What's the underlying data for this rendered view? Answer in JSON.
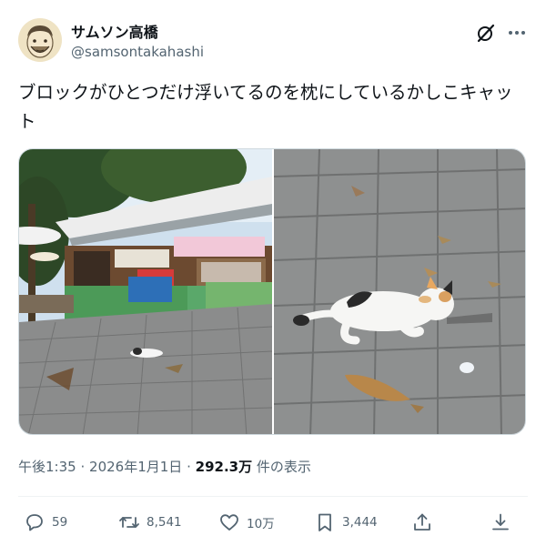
{
  "author": {
    "name": "サムソン高橋",
    "handle": "@samsontakahashi"
  },
  "post": {
    "text": "ブロックがひとつだけ浮いてるのを枕にしているかしこキャット"
  },
  "meta": {
    "time": "午後1:35",
    "separator": "·",
    "date": "2026年1月1日",
    "views_count": "292.3万",
    "views_label": "件の表示"
  },
  "actions": {
    "replies": "59",
    "reposts": "8,541",
    "likes": "10万",
    "bookmarks": "3,444"
  },
  "icons": [
    "grok-icon",
    "more-icon",
    "reply-icon",
    "repost-icon",
    "like-icon",
    "bookmark-icon",
    "share-icon",
    "download-icon"
  ]
}
